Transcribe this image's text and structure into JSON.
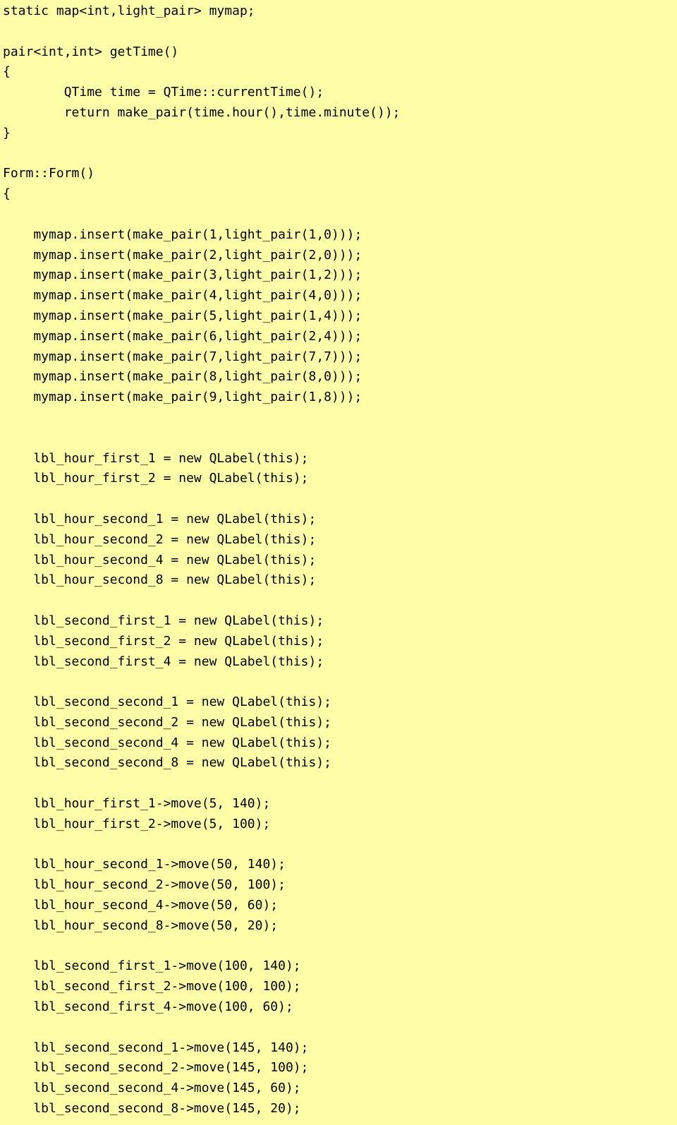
{
  "code": {
    "lines": [
      "static map<int,light_pair> mymap;",
      "",
      "pair<int,int> getTime()",
      "{",
      "        QTime time = QTime::currentTime();",
      "        return make_pair(time.hour(),time.minute());",
      "}",
      "",
      "Form::Form()",
      "{",
      "",
      "    mymap.insert(make_pair(1,light_pair(1,0)));",
      "    mymap.insert(make_pair(2,light_pair(2,0)));",
      "    mymap.insert(make_pair(3,light_pair(1,2)));",
      "    mymap.insert(make_pair(4,light_pair(4,0)));",
      "    mymap.insert(make_pair(5,light_pair(1,4)));",
      "    mymap.insert(make_pair(6,light_pair(2,4)));",
      "    mymap.insert(make_pair(7,light_pair(7,7)));",
      "    mymap.insert(make_pair(8,light_pair(8,0)));",
      "    mymap.insert(make_pair(9,light_pair(1,8)));",
      "",
      "",
      "    lbl_hour_first_1 = new QLabel(this);",
      "    lbl_hour_first_2 = new QLabel(this);",
      "",
      "    lbl_hour_second_1 = new QLabel(this);",
      "    lbl_hour_second_2 = new QLabel(this);",
      "    lbl_hour_second_4 = new QLabel(this);",
      "    lbl_hour_second_8 = new QLabel(this);",
      "",
      "    lbl_second_first_1 = new QLabel(this);",
      "    lbl_second_first_2 = new QLabel(this);",
      "    lbl_second_first_4 = new QLabel(this);",
      "",
      "    lbl_second_second_1 = new QLabel(this);",
      "    lbl_second_second_2 = new QLabel(this);",
      "    lbl_second_second_4 = new QLabel(this);",
      "    lbl_second_second_8 = new QLabel(this);",
      "",
      "    lbl_hour_first_1->move(5, 140);",
      "    lbl_hour_first_2->move(5, 100);",
      "",
      "    lbl_hour_second_1->move(50, 140);",
      "    lbl_hour_second_2->move(50, 100);",
      "    lbl_hour_second_4->move(50, 60);",
      "    lbl_hour_second_8->move(50, 20);",
      "",
      "    lbl_second_first_1->move(100, 140);",
      "    lbl_second_first_2->move(100, 100);",
      "    lbl_second_first_4->move(100, 60);",
      "",
      "    lbl_second_second_1->move(145, 140);",
      "    lbl_second_second_2->move(145, 100);",
      "    lbl_second_second_4->move(145, 60);",
      "    lbl_second_second_8->move(145, 20);"
    ]
  }
}
